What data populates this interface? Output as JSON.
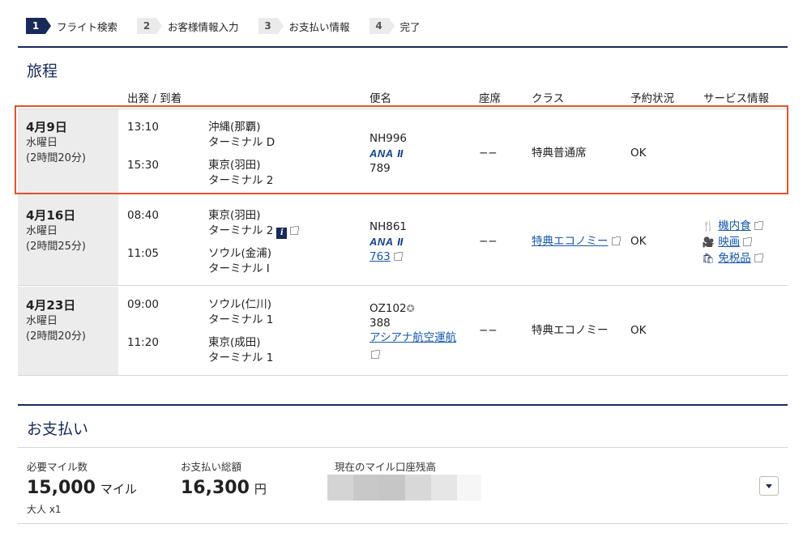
{
  "steps": [
    {
      "num": "1",
      "label": "フライト検索"
    },
    {
      "num": "2",
      "label": "お客様情報入力"
    },
    {
      "num": "3",
      "label": "お支払い情報"
    },
    {
      "num": "4",
      "label": "完了"
    }
  ],
  "itinerary": {
    "title": "旅程",
    "headers": {
      "depart_arrive": "出発 / 到着",
      "flight": "便名",
      "seat": "座席",
      "class": "クラス",
      "status": "予約状況",
      "service": "サービス情報"
    },
    "rows": [
      {
        "date": "4月9日",
        "weekday": "水曜日",
        "duration": "(2時間20分)",
        "dep_time": "13:10",
        "dep_place": "沖縄(那覇)",
        "dep_terminal": "ターミナル D",
        "arr_time": "15:30",
        "arr_place": "東京(羽田)",
        "arr_terminal": "ターミナル 2",
        "flight_no": "NH996",
        "airline_logo": "ANA",
        "aircraft": "789",
        "seat": "−−",
        "class": "特典普通席",
        "status": "OK"
      },
      {
        "date": "4月16日",
        "weekday": "水曜日",
        "duration": "(2時間25分)",
        "dep_time": "08:40",
        "dep_place": "東京(羽田)",
        "dep_terminal": "ターミナル 2",
        "arr_time": "11:05",
        "arr_place": "ソウル(金浦)",
        "arr_terminal": "ターミナル I",
        "flight_no": "NH861",
        "airline_logo": "ANA",
        "aircraft": "763",
        "seat": "−−",
        "class": "特典エコノミー",
        "status": "OK",
        "services": [
          "機内食",
          "映画",
          "免税品"
        ]
      },
      {
        "date": "4月23日",
        "weekday": "水曜日",
        "duration": "(2時間20分)",
        "dep_time": "09:00",
        "dep_place": "ソウル(仁川)",
        "dep_terminal": "ターミナル 1",
        "arr_time": "11:20",
        "arr_place": "東京(成田)",
        "arr_terminal": "ターミナル 1",
        "flight_no": "OZ102",
        "aircraft": "388",
        "operator": "アシアナ航空運航",
        "seat": "−−",
        "class": "特典エコノミー",
        "status": "OK"
      }
    ]
  },
  "payment": {
    "title": "お支払い",
    "miles_label": "必要マイル数",
    "miles_value": "15,000",
    "miles_unit": "マイル",
    "passengers": "大人 x1",
    "total_label": "お支払い総額",
    "total_value": "16,300",
    "total_unit": "円",
    "balance_label": "現在のマイル口座残高"
  },
  "colors": {
    "navy": "#172a5a",
    "link": "#1558b0",
    "highlight": "#e5532d"
  },
  "icons": {
    "info": "info-icon",
    "external": "external-link-icon",
    "meal": "fork-knife-icon",
    "movie": "film-camera-icon",
    "dutyfree": "shopping-bottle-icon",
    "star_alliance": "star-icon",
    "dropdown": "chevron-down-icon"
  }
}
